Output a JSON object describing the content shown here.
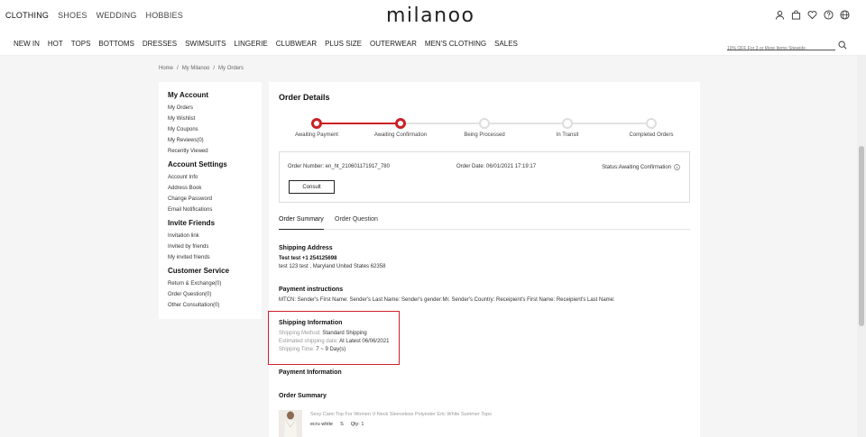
{
  "header": {
    "categories": [
      {
        "label": "CLOTHING",
        "active": true
      },
      {
        "label": "SHOES",
        "active": false
      },
      {
        "label": "WEDDING",
        "active": false
      },
      {
        "label": "HOBBIES",
        "active": false
      }
    ],
    "logo": "milanoo",
    "icons": [
      "user-icon",
      "bag-icon",
      "heart-icon",
      "help-icon",
      "globe-icon"
    ]
  },
  "nav": {
    "items": [
      "NEW IN",
      "HOT",
      "TOPS",
      "BOTTOMS",
      "DRESSES",
      "SWIMSUITS",
      "LINGERIE",
      "CLUBWEAR",
      "PLUS SIZE",
      "OUTERWEAR",
      "MEN'S CLOTHING",
      "SALES"
    ],
    "search_placeholder": "10% OFF For 3 or More Items Sitewide"
  },
  "breadcrumb": [
    "Home",
    "/",
    "My Milanoo",
    "/",
    "My Orders"
  ],
  "sidebar": {
    "groups": [
      {
        "title": "My Account",
        "items": [
          "My Orders",
          "My Wishlist",
          "My Coupons",
          "My Reviews(0)",
          "Recently Viewed"
        ]
      },
      {
        "title": "Account Settings",
        "items": [
          "Account Info",
          "Address Book",
          "Change Password",
          "Email Notifications"
        ]
      },
      {
        "title": "Invite Friends",
        "items": [
          "Invitation link",
          "Invited by friends",
          "My invited friends"
        ]
      },
      {
        "title": "Customer Service",
        "items": [
          "Return & Exchange(0)",
          "Order Question(0)",
          "Other Consultation(0)"
        ]
      }
    ]
  },
  "order": {
    "title": "Order Details",
    "steps": [
      {
        "label": "Awaiting Payment",
        "done": true
      },
      {
        "label": "Awaiting Confirmation",
        "done": true
      },
      {
        "label": "Being Processed",
        "done": false
      },
      {
        "label": "In Transit",
        "done": false
      },
      {
        "label": "Completed Orders",
        "done": false
      }
    ],
    "order_number": "Order Number: en_ht_210601171917_780",
    "order_date": "Order Date: 06/01/2021 17:19:17",
    "status": "Status:Awaiting Confirmation",
    "consult_label": "Consult",
    "tabs": [
      {
        "label": "Order Summary",
        "active": true
      },
      {
        "label": "Order Question",
        "active": false
      }
    ],
    "shipping_address": {
      "title": "Shipping Address",
      "name": "Test test +1 254125698",
      "address": "test 123 test , Maryland United States 62358"
    },
    "payment_instructions": {
      "title": "Payment instructions",
      "text": "MTCN: Sender's First Name: Sender's Last Name: Sender's gender:Mr. Sender's Country: Receipient's First Name: Receipient's Last Name:"
    },
    "shipping_info": {
      "title": "Shipping Information",
      "method_label": "Shipping Method:",
      "method_value": "Standard Shipping",
      "date_label": "Estimated shipping date:",
      "date_value": "At Latest 06/06/2021",
      "time_label": "Shipping Time:",
      "time_value": "7 ~ 9 Day(s)"
    },
    "payment_info_title": "Payment Information",
    "order_summary_title": "Order Summary",
    "product": {
      "name": "Sexy Cami Top For Women V-Neck Sleeveless Polyester Eric White Summer Tops",
      "color": "ecru white",
      "size": "S",
      "qty": "Qty: 1"
    }
  },
  "colors": {
    "accent": "#cc1f24",
    "highlight": "#d0202a"
  }
}
